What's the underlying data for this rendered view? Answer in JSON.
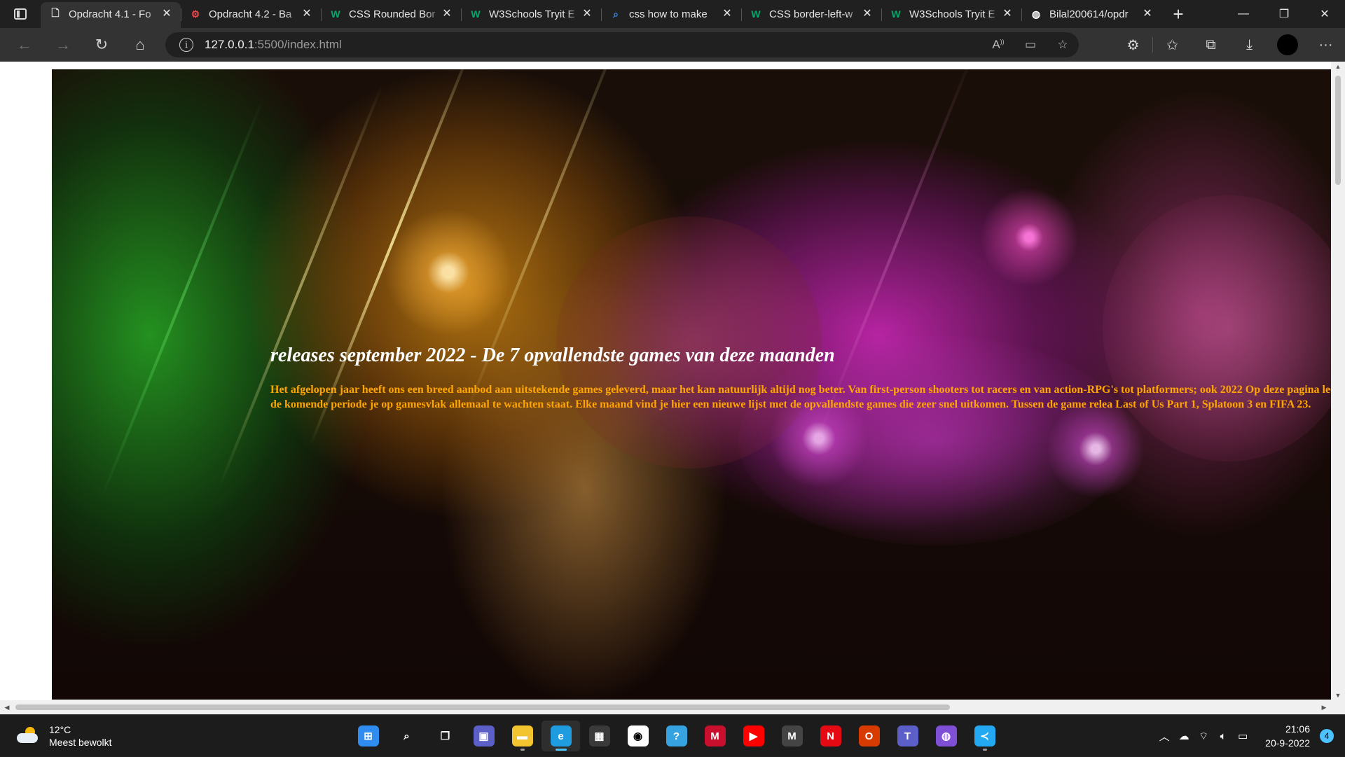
{
  "tabs": [
    {
      "title": "Opdracht 4.1 - Fo",
      "icon": "page-icon",
      "active": true
    },
    {
      "title": "Opdracht 4.2 - Ba",
      "icon": "red-gear-icon",
      "active": false
    },
    {
      "title": "CSS Rounded Bor",
      "icon": "w3schools-icon",
      "active": false
    },
    {
      "title": "W3Schools Tryit E",
      "icon": "w3schools-icon",
      "active": false
    },
    {
      "title": "css how to make",
      "icon": "search-icon",
      "active": false
    },
    {
      "title": "CSS border-left-w",
      "icon": "w3schools-icon",
      "active": false
    },
    {
      "title": "W3Schools Tryit E",
      "icon": "w3schools-icon",
      "active": false
    },
    {
      "title": "Bilal200614/opdr",
      "icon": "github-icon",
      "active": false
    }
  ],
  "address": {
    "host": "127.0.0.1",
    "path": ":5500/index.html"
  },
  "page": {
    "heading": "releases september 2022 - De 7 opvallendste games van deze maanden",
    "paragraph": "Het afgelopen jaar heeft ons een breed aanbod aan uitstekende games geleverd, maar het kan natuurlijk altijd nog beter. Van first-person shooters tot racers en van action-RPG's tot platformers; ook 2022 Op deze pagina lees je wat de komende periode je op gamesvlak allemaal te wachten staat. Elke maand vind je hier een nieuwe lijst met de opvallendste games die zeer snel uitkomen. Tussen de game relea Last of Us Part 1, Splatoon 3 en FIFA 23."
  },
  "weather": {
    "temp": "12°C",
    "condition": "Meest bewolkt"
  },
  "taskbar_apps": [
    {
      "name": "windows-start",
      "glyph": "⊞",
      "color": "#2f8cf0"
    },
    {
      "name": "search",
      "glyph": "⌕",
      "color": "transparent"
    },
    {
      "name": "task-view",
      "glyph": "❐",
      "color": "transparent"
    },
    {
      "name": "teams-chat",
      "glyph": "▣",
      "color": "#5b5fc7"
    },
    {
      "name": "file-explorer",
      "glyph": "▬",
      "color": "#f4c430"
    },
    {
      "name": "edge",
      "glyph": "e",
      "color": "#1f9be0",
      "active": true
    },
    {
      "name": "microsoft-store",
      "glyph": "▦",
      "color": "#3a3a3a"
    },
    {
      "name": "app-circle",
      "glyph": "◉",
      "color": "#ffffff"
    },
    {
      "name": "get-help",
      "glyph": "?",
      "color": "#36a3e0"
    },
    {
      "name": "mcafee",
      "glyph": "M",
      "color": "#c8102e"
    },
    {
      "name": "youtube",
      "glyph": "▶",
      "color": "#ff0000"
    },
    {
      "name": "m-app",
      "glyph": "M",
      "color": "#444444"
    },
    {
      "name": "netflix",
      "glyph": "N",
      "color": "#e50914"
    },
    {
      "name": "office",
      "glyph": "O",
      "color": "#d83b01"
    },
    {
      "name": "teams",
      "glyph": "T",
      "color": "#5b5fc7"
    },
    {
      "name": "github-desktop",
      "glyph": "◍",
      "color": "#7f4fd6"
    },
    {
      "name": "vscode",
      "glyph": "≺",
      "color": "#23a9f2"
    }
  ],
  "clock": {
    "time": "21:06",
    "date": "20-9-2022"
  },
  "notification_count": "4",
  "colors": {
    "heading": "#ffffff",
    "paragraph": "#ffa500",
    "accent": "#4cc2ff"
  }
}
